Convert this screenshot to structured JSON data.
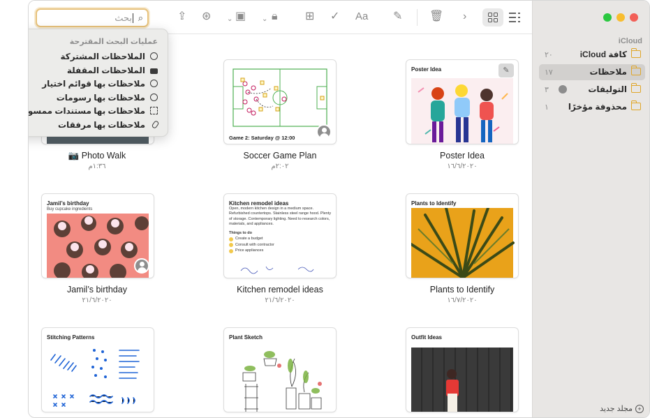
{
  "toolbar": {
    "search_placeholder": "بحث",
    "icons": [
      "search-icon",
      "share-icon",
      "collaborate-icon",
      "media-icon",
      "lock-icon",
      "table-icon",
      "checklist-icon",
      "format-icon",
      "compose-icon",
      "trash-icon",
      "chevron-right-icon",
      "gallery-view-icon",
      "list-view-icon"
    ]
  },
  "search_suggestions": {
    "header": "عمليات البحث المقترحة",
    "items": [
      {
        "label": "الملاحظات المشتركة",
        "icon": "shared-person-icon"
      },
      {
        "label": "الملاحظات المقفلة",
        "icon": "lock-icon"
      },
      {
        "label": "ملاحظات بها قوائم اختيار",
        "icon": "checkmark-circle-icon"
      },
      {
        "label": "ملاحظات بها رسومات",
        "icon": "pencil-circle-icon"
      },
      {
        "label": "ملاحظات بها مستندات ممسوحة ضوئيًا",
        "icon": "scan-icon"
      },
      {
        "label": "ملاحظات بها مرفقات",
        "icon": "paperclip-icon"
      }
    ]
  },
  "sidebar": {
    "section": "iCloud",
    "folders": [
      {
        "name": "كافة iCloud",
        "count": "٢٠",
        "selected": false
      },
      {
        "name": "ملاحظات",
        "count": "١٧",
        "selected": true
      },
      {
        "name": "التوليفات",
        "count": "٣",
        "selected": false
      },
      {
        "name": "محذوفة مؤخرًا",
        "count": "١",
        "selected": false
      }
    ],
    "new_folder": "مجلد جديد"
  },
  "notes": [
    {
      "caption": "📷 Photo Walk",
      "date": "١:٣٦م"
    },
    {
      "caption": "Soccer Game Plan",
      "date": "٢:٠٢م",
      "card_footer": "Game 2: Saturday @ 12:00"
    },
    {
      "caption": "Poster Idea",
      "date": "١٦/٦/٢٠٢٠",
      "card_title": "Poster Idea"
    },
    {
      "caption": "Jamil’s birthday",
      "date": "٢١/٦/٢٠٢٠",
      "card_title": "Jamil’s birthday",
      "card_sub": "Buy cupcake ingredients"
    },
    {
      "caption": "Kitchen remodel ideas",
      "date": "٢١/٦/٢٠٢٠",
      "card_title": "Kitchen remodel ideas",
      "card_body": "Open, modern kitchen design in a medium space. Refurbished countertops. Stainless steel range hood. Plenty of storage. Contemporary lighting. Need to research colors, materials, and appliances.",
      "card_subhead": "Things to do",
      "todos": [
        "Create a budget",
        "Consult with contractor",
        "Price appliances"
      ]
    },
    {
      "caption": "Plants to Identify",
      "date": "١٦/٧/٢٠٢٠",
      "card_title": "Plants to Identify"
    },
    {
      "caption": "",
      "date": "",
      "card_title": "Stitching Patterns"
    },
    {
      "caption": "",
      "date": "",
      "card_title": "Plant Sketch"
    },
    {
      "caption": "",
      "date": "",
      "card_title": "Outfit Ideas"
    }
  ],
  "colors": {
    "accent": "#e0a628",
    "search_focus": "#e7c27c",
    "sidebar_bg": "#e8e6e4",
    "close": "#f25f57",
    "minimize": "#f8bd2f",
    "zoom": "#2bc840"
  }
}
